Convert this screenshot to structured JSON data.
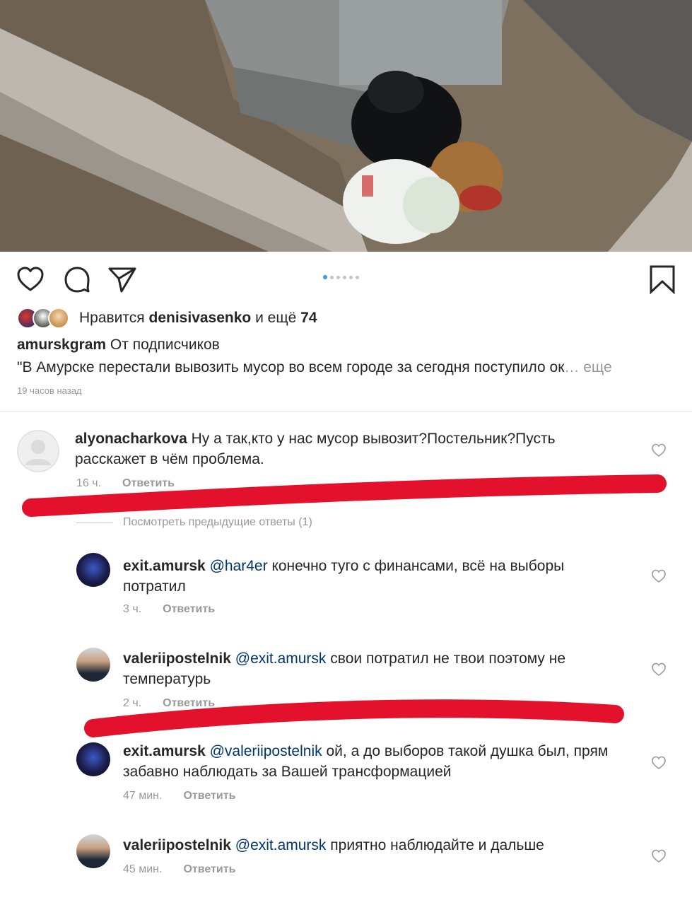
{
  "actions": {
    "like_icon": "heart-outline-icon",
    "comment_icon": "comment-bubble-icon",
    "share_icon": "paper-plane-icon",
    "save_icon": "bookmark-icon",
    "carousel_pages": 6,
    "carousel_active": 1
  },
  "likes": {
    "prefix": "Нравится",
    "user": "denisivasenko",
    "middle": "и ещё",
    "count": "74"
  },
  "caption": {
    "user": "amurskgram",
    "label": "От подписчиков",
    "text": "\"В Амурске перестали вывозить мусор во всем городе за сегодня поступило ок",
    "ellipsis": "…",
    "more": "еще",
    "time": "19 часов назад"
  },
  "comments": [
    {
      "user": "alyonacharkova",
      "mention": "",
      "text": "Ну а так,кто у нас мусор вывозит?Постельник?Пусть расскажет в чём проблема.",
      "time": "16 ч.",
      "reply": "Ответить"
    },
    {
      "user": "exit.amursk",
      "mention": "@har4er",
      "text": "конечно туго с финансами, всё на выборы потратил",
      "time": "3 ч.",
      "reply": "Ответить"
    },
    {
      "user": "valeriipostelnik",
      "mention": "@exit.amursk",
      "text": "свои потратил не твои поэтому не температурь",
      "time": "2 ч.",
      "reply": "Ответить"
    },
    {
      "user": "exit.amursk",
      "mention": "@valeriipostelnik",
      "text": "ой, а до выборов такой душка был, прям забавно наблюдать за Вашей трансформацией",
      "time": "47 мин.",
      "reply": "Ответить"
    },
    {
      "user": "valeriipostelnik",
      "mention": "@exit.amursk",
      "text": "приятно наблюдайте и дальше",
      "time": "45 мин.",
      "reply": "Ответить"
    }
  ],
  "view_previous": "Посмотреть предыдущие ответы (1)",
  "colors": {
    "mention": "#003569",
    "muted": "#999999",
    "annotation_red": "#e3112c",
    "carousel_active": "#3897f0"
  }
}
